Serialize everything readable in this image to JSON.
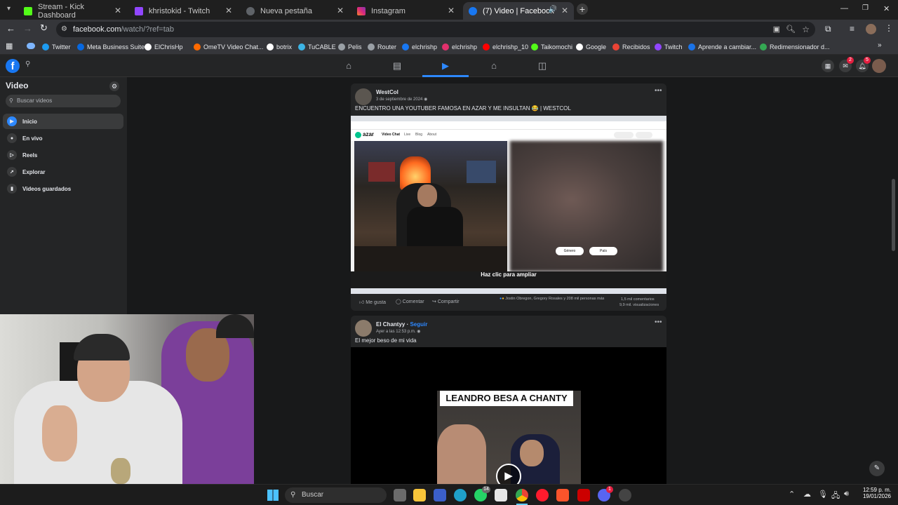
{
  "browser": {
    "tabs": [
      {
        "title": "Stream - Kick Dashboard",
        "color": "#53fc18"
      },
      {
        "title": "khristokid - Twitch",
        "color": "#9146ff"
      },
      {
        "title": "Nueva pestaña",
        "color": "#9aa0a6"
      },
      {
        "title": "Instagram",
        "color": "#e1306c"
      },
      {
        "title": "(7) Video | Facebook",
        "color": "#1877f2"
      }
    ],
    "url_domain": "facebook.com",
    "url_path": "/watch/?ref=tab",
    "bookmarks": [
      {
        "label": "Twitter",
        "color": "#1d9bf0"
      },
      {
        "label": "Meta Business Suite",
        "color": "#0668e1"
      },
      {
        "label": "ElChrisHp",
        "color": "#ffffff"
      },
      {
        "label": "OmeTV Video Chat...",
        "color": "#ff6a00"
      },
      {
        "label": "botrix",
        "color": "#ffffff"
      },
      {
        "label": "TuCABLE",
        "color": "#3cb4e5"
      },
      {
        "label": "Pelis",
        "color": "#9aa0a6"
      },
      {
        "label": "Router",
        "color": "#9aa0a6"
      },
      {
        "label": "elchrishp",
        "color": "#1877f2"
      },
      {
        "label": "elchrishp",
        "color": "#e1306c"
      },
      {
        "label": "elchrishp_10",
        "color": "#ff0000"
      },
      {
        "label": "Taikomochi",
        "color": "#53fc18"
      },
      {
        "label": "Google",
        "color": "#ffffff"
      },
      {
        "label": "Recibidos",
        "color": "#ea4335"
      },
      {
        "label": "Twitch",
        "color": "#9146ff"
      },
      {
        "label": "Aprende a cambiar...",
        "color": "#1a73e8"
      },
      {
        "label": "Redimensionador d...",
        "color": "#34a853"
      }
    ]
  },
  "facebook": {
    "header_badges": {
      "messages": "2",
      "notifications": "5"
    },
    "sidebar": {
      "title": "Video",
      "search_placeholder": "Buscar videos",
      "items": [
        {
          "label": "Inicio"
        },
        {
          "label": "En vivo"
        },
        {
          "label": "Reels"
        },
        {
          "label": "Explorar"
        },
        {
          "label": "Videos guardados"
        }
      ]
    },
    "post1": {
      "author": "WestCol",
      "date": "3 de septiembre de 2024",
      "caption": "ENCUENTRO UNA YOUTUBER FAMOSA EN AZAR Y ME INSULTAN 😂 | WESTCOL",
      "video_overlay": "Haz clic para ampliar",
      "azar_brand": "azar",
      "azar_nav": [
        "Video Chat",
        "Live",
        "Blog",
        "About"
      ],
      "azar_chips": [
        "Género",
        "País"
      ],
      "actions": {
        "like": "Me gusta",
        "comment": "Comentar",
        "share": "Compartir"
      },
      "reactions_text": "Jostin Obregon, Gregory Rosales y 208 mil personas más",
      "comments": "1,5 mil comentarios",
      "views": "9,9 mil. visualizaciones"
    },
    "post2": {
      "author": "El Chantyy",
      "follow": "Seguir",
      "date": "Ayer a las 12:53 p.m.",
      "caption": "El mejor beso de mi vida",
      "video_title": "LEANDRO BESA A CHANTY"
    }
  },
  "taskbar": {
    "search_placeholder": "Buscar",
    "time": "12:59 p. m.",
    "date": "19/01/2026",
    "whatsapp_badge": "14",
    "discord_badge": "1"
  }
}
